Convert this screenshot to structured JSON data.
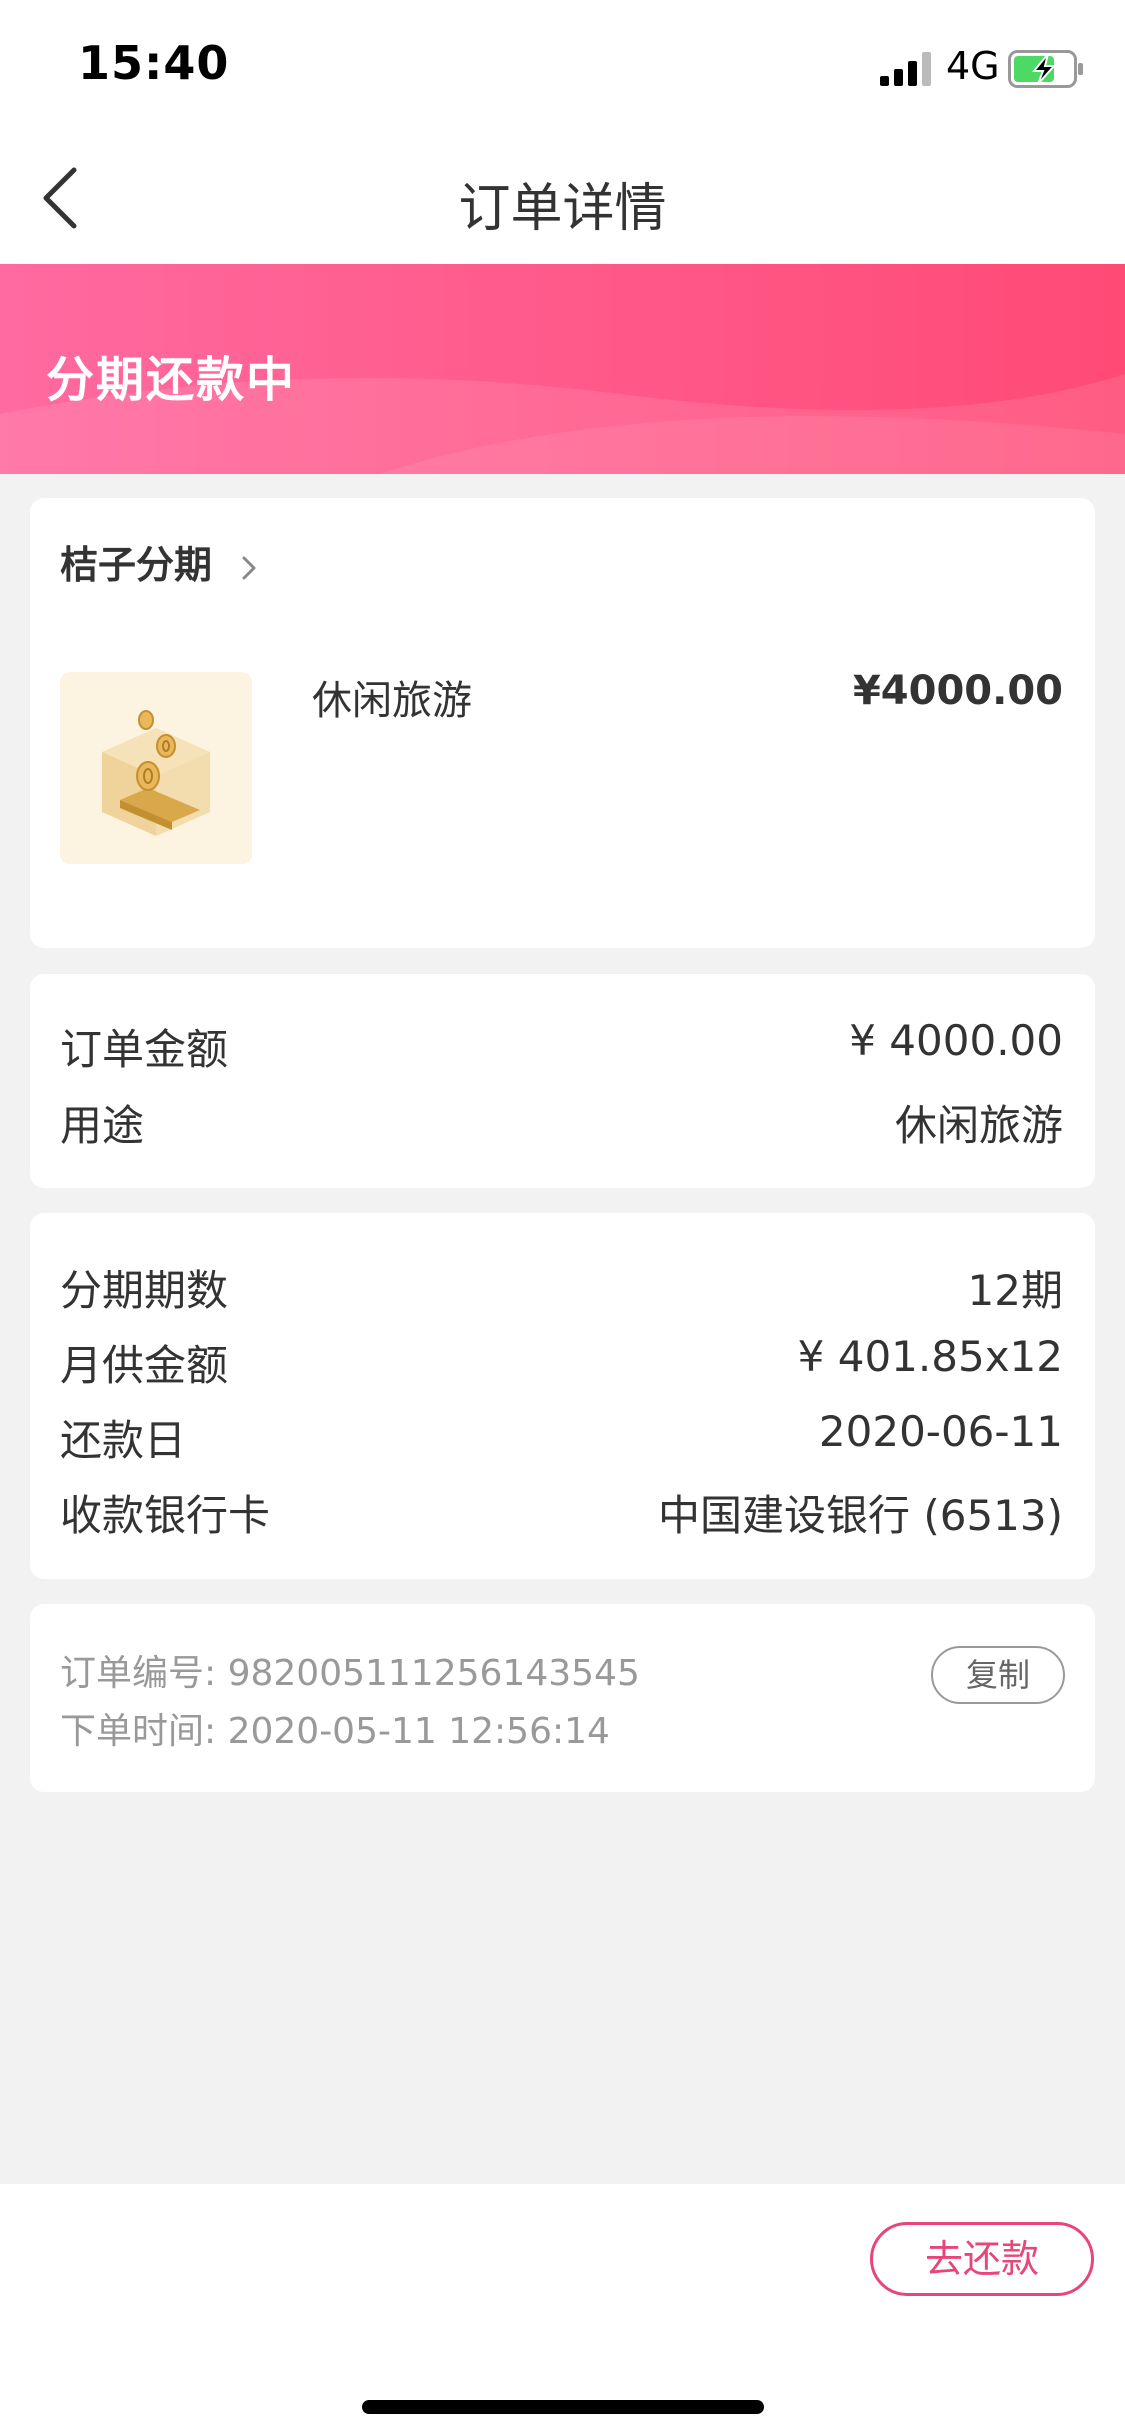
{
  "status_bar": {
    "time": "15:40",
    "network": "4G"
  },
  "nav": {
    "title": "订单详情"
  },
  "banner": {
    "status": "分期还款中",
    "color": "#ff5a8a"
  },
  "product_card": {
    "merchant": "桔子分期",
    "item_name": "休闲旅游",
    "item_price": "¥4000.00"
  },
  "order_summary": {
    "rows": [
      {
        "label": "订单金额",
        "value": "¥ 4000.00"
      },
      {
        "label": "用途",
        "value": "休闲旅游"
      }
    ]
  },
  "installment": {
    "rows": [
      {
        "label": "分期期数",
        "value": "12期"
      },
      {
        "label": "月供金额",
        "value": "¥ 401.85x12"
      },
      {
        "label": "还款日",
        "value": "2020-06-11"
      },
      {
        "label": "收款银行卡",
        "value": "中国建设银行 (6513)"
      }
    ]
  },
  "order_meta": {
    "order_no": "订单编号: 982005111256143545",
    "order_time": "下单时间: 2020-05-11 12:56:14",
    "copy_label": "复制"
  },
  "actions": {
    "repay_label": "去还款",
    "accent": "#e8467a"
  },
  "icons": [
    "back-arrow-icon",
    "chevron-right-icon",
    "signal-icon",
    "battery-charging-icon",
    "gold-coin-box-icon"
  ]
}
